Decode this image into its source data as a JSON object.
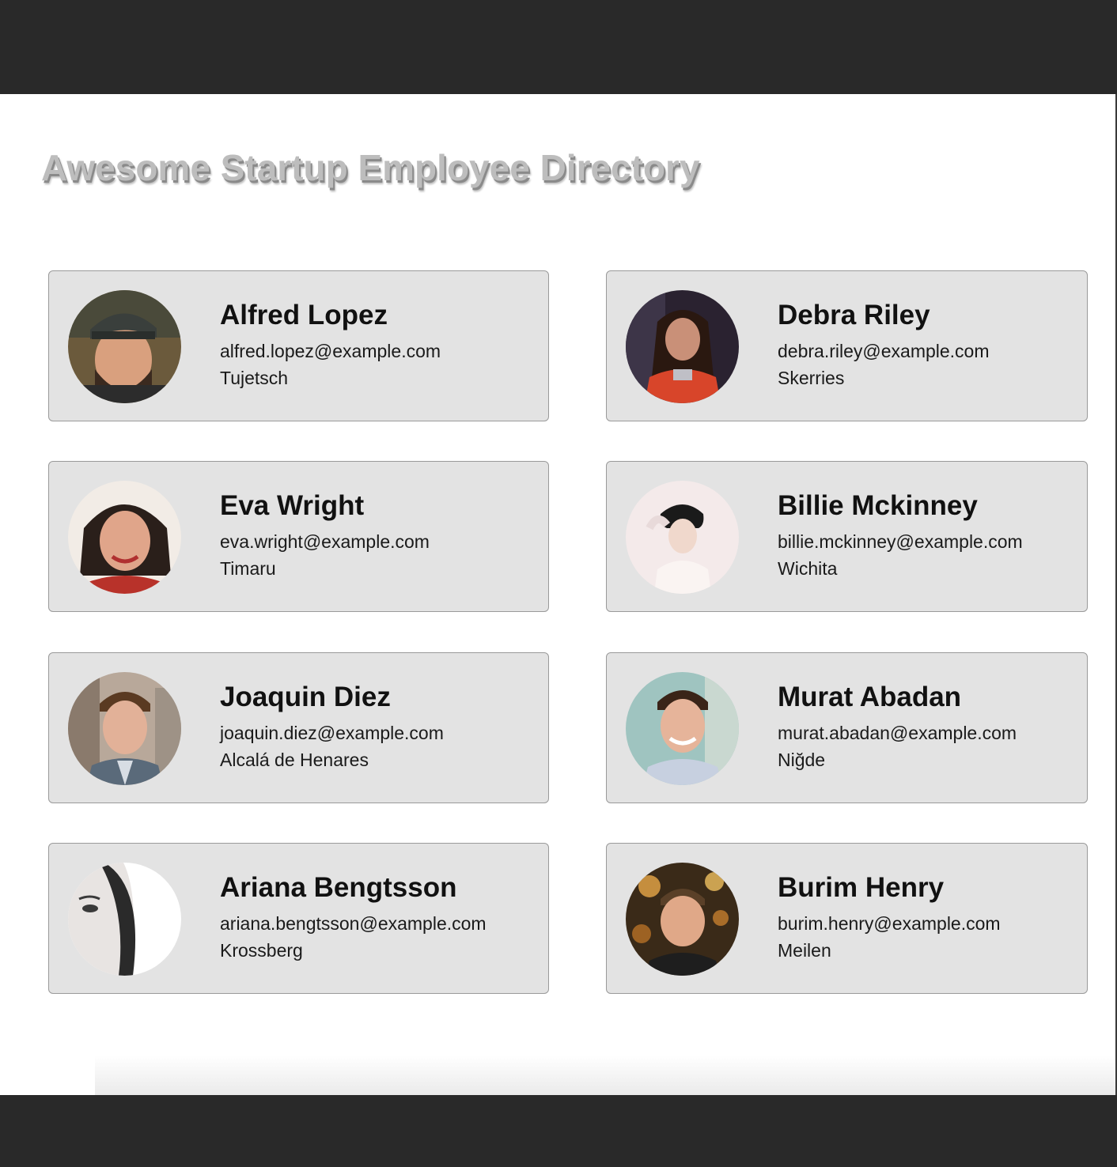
{
  "header": {
    "title": "Awesome Startup Employee Directory"
  },
  "employees": [
    {
      "name": "Alfred Lopez",
      "email": "alfred.lopez@example.com",
      "city": "Tujetsch"
    },
    {
      "name": "Debra Riley",
      "email": "debra.riley@example.com",
      "city": "Skerries"
    },
    {
      "name": "Eva Wright",
      "email": "eva.wright@example.com",
      "city": "Timaru"
    },
    {
      "name": "Billie Mckinney",
      "email": "billie.mckinney@example.com",
      "city": "Wichita"
    },
    {
      "name": "Joaquin Diez",
      "email": "joaquin.diez@example.com",
      "city": "Alcalá de Henares"
    },
    {
      "name": "Murat Abadan",
      "email": "murat.abadan@example.com",
      "city": "Niğde"
    },
    {
      "name": "Ariana Bengtsson",
      "email": "ariana.bengtsson@example.com",
      "city": "Krossberg"
    },
    {
      "name": "Burim Henry",
      "email": "burim.henry@example.com",
      "city": "Meilen"
    }
  ],
  "colors": {
    "card_background": "#e3e3e3",
    "card_border": "#9a9a9a",
    "title_text": "#bdbdbd",
    "title_shadow": "#8a8a8a",
    "frame_background": "#292929"
  }
}
